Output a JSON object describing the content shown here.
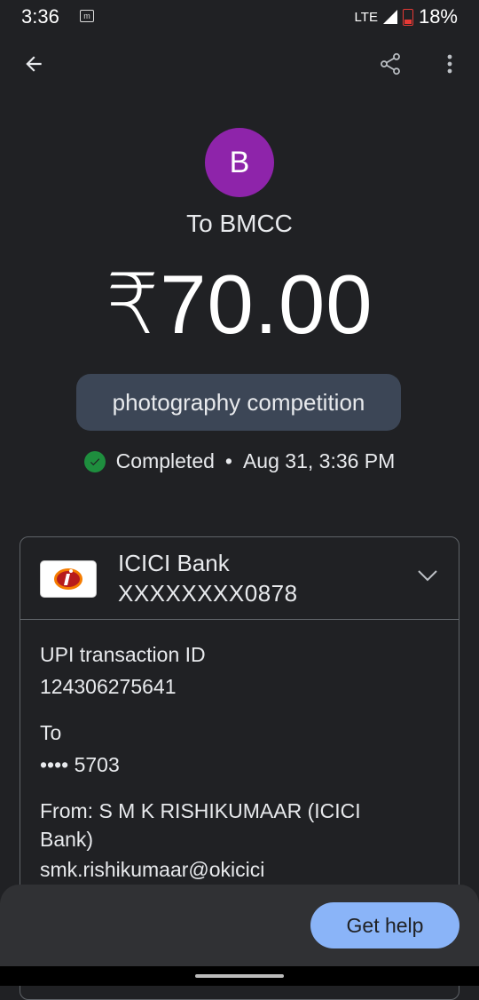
{
  "status_bar": {
    "time": "3:36",
    "network": "LTE",
    "battery": "18%"
  },
  "payee": {
    "initial": "B",
    "title": "To BMCC"
  },
  "amount": "₹70.00",
  "note": "photography competition",
  "status": {
    "text": "Completed",
    "separator": "•",
    "datetime": "Aug 31, 3:36 PM"
  },
  "bank": {
    "name": "ICICI Bank",
    "account": "XXXXXXXX0878"
  },
  "details": {
    "upi_label": "UPI transaction ID",
    "upi_value": "124306275641",
    "to_label": "To",
    "to_value": "•••• 5703",
    "from_label": "From: S M K RISHIKUMAAR (ICICI",
    "from_label_2": "Bank)",
    "from_value": "smk.rishikumaar@okicici"
  },
  "help_button": "Get help",
  "colors": {
    "background": "#202124",
    "avatar": "#8e24aa",
    "success": "#1e8e3e",
    "help_button": "#8ab4f8"
  }
}
